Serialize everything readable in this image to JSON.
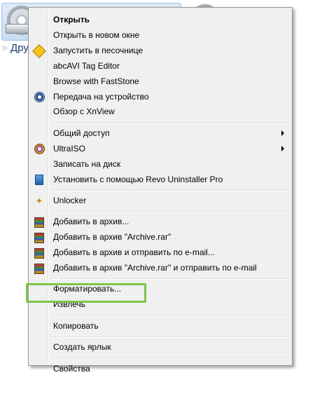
{
  "background": {
    "tree_label": "Дру"
  },
  "menu": {
    "groups": [
      [
        {
          "label": "Открыть",
          "bold": true,
          "icon": "none"
        },
        {
          "label": "Открыть в новом окне",
          "icon": "none"
        },
        {
          "label": "Запустить в песочнице",
          "icon": "sandbox-icon"
        },
        {
          "label": "abcAVI Tag Editor",
          "icon": "none"
        },
        {
          "label": "Browse with FastStone",
          "icon": "none"
        },
        {
          "label": "Передача на устройство",
          "icon": "device-icon"
        },
        {
          "label": "Обзор с XnView",
          "icon": "none"
        }
      ],
      [
        {
          "label": "Общий доступ",
          "icon": "none",
          "submenu": true
        },
        {
          "label": "UltraISO",
          "icon": "ultraiso-icon",
          "submenu": true
        },
        {
          "label": "Записать на диск",
          "icon": "none"
        },
        {
          "label": "Установить с помощью Revo Uninstaller Pro",
          "icon": "revo-uninstaller-icon"
        }
      ],
      [
        {
          "label": "Unlocker",
          "icon": "unlocker-wand-icon"
        }
      ],
      [
        {
          "label": "Добавить в архив...",
          "icon": "winrar-icon"
        },
        {
          "label": "Добавить в архив \"Archive.rar\"",
          "icon": "winrar-icon"
        },
        {
          "label": "Добавить в архив и отправить по e-mail...",
          "icon": "winrar-icon"
        },
        {
          "label": "Добавить в архив \"Archive.rar\" и отправить по e-mail",
          "icon": "winrar-icon"
        }
      ],
      [
        {
          "label": "Форматировать...",
          "icon": "none"
        },
        {
          "label": "Извлечь",
          "icon": "none",
          "highlighted": true
        }
      ],
      [
        {
          "label": "Копировать",
          "icon": "none"
        }
      ],
      [
        {
          "label": "Создать ярлык",
          "icon": "none"
        }
      ],
      [
        {
          "label": "Свойства",
          "icon": "none"
        }
      ]
    ]
  },
  "colors": {
    "menu_background": "#f0f0f0",
    "highlight_border": "#7dc54a"
  }
}
